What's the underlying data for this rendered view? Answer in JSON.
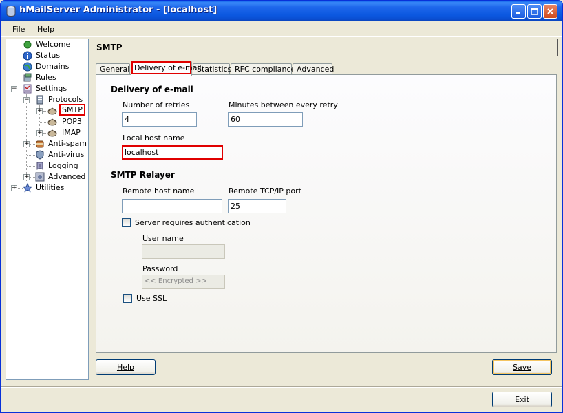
{
  "window": {
    "title": "hMailServer Administrator - [localhost]"
  },
  "menu": {
    "file": "File",
    "help": "Help"
  },
  "tree": {
    "items": [
      {
        "label": "Welcome",
        "icon": "globe-green-icon"
      },
      {
        "label": "Status",
        "icon": "info-icon"
      },
      {
        "label": "Domains",
        "icon": "globe-icon"
      },
      {
        "label": "Rules",
        "icon": "rules-icon"
      },
      {
        "label": "Settings",
        "icon": "settings-icon"
      },
      {
        "label": "Protocols",
        "icon": "server-icon"
      },
      {
        "label": "SMTP",
        "icon": "protocol-icon"
      },
      {
        "label": "POP3",
        "icon": "protocol-icon"
      },
      {
        "label": "IMAP",
        "icon": "protocol-icon"
      },
      {
        "label": "Anti-spam",
        "icon": "antispam-icon"
      },
      {
        "label": "Anti-virus",
        "icon": "antivirus-icon"
      },
      {
        "label": "Logging",
        "icon": "logging-icon"
      },
      {
        "label": "Advanced",
        "icon": "advanced-icon"
      },
      {
        "label": "Utilities",
        "icon": "star-icon"
      }
    ]
  },
  "header": {
    "title": "SMTP"
  },
  "tabs": {
    "general": "General",
    "delivery": "Delivery of e-mail",
    "statistics": "Statistics",
    "rfc": "RFC compliance",
    "advanced": "Advanced"
  },
  "delivery": {
    "section_title": "Delivery of e-mail",
    "retries_label": "Number of retries",
    "retries_value": "4",
    "minutes_label": "Minutes between every retry",
    "minutes_value": "60",
    "localhost_label": "Local host name",
    "localhost_value": "localhost"
  },
  "relayer": {
    "section_title": "SMTP Relayer",
    "remote_host_label": "Remote host name",
    "remote_host_value": "",
    "port_label": "Remote TCP/IP port",
    "port_value": "25",
    "auth_label": "Server requires authentication",
    "username_label": "User name",
    "username_value": "",
    "password_label": "Password",
    "password_value": "<< Encrypted >>",
    "ssl_label": "Use SSL"
  },
  "buttons": {
    "help": "Help",
    "save": "Save",
    "exit": "Exit"
  },
  "colors": {
    "titlebar": "#0a58e0",
    "highlight": "#e00000",
    "focus": "#f4c562"
  }
}
